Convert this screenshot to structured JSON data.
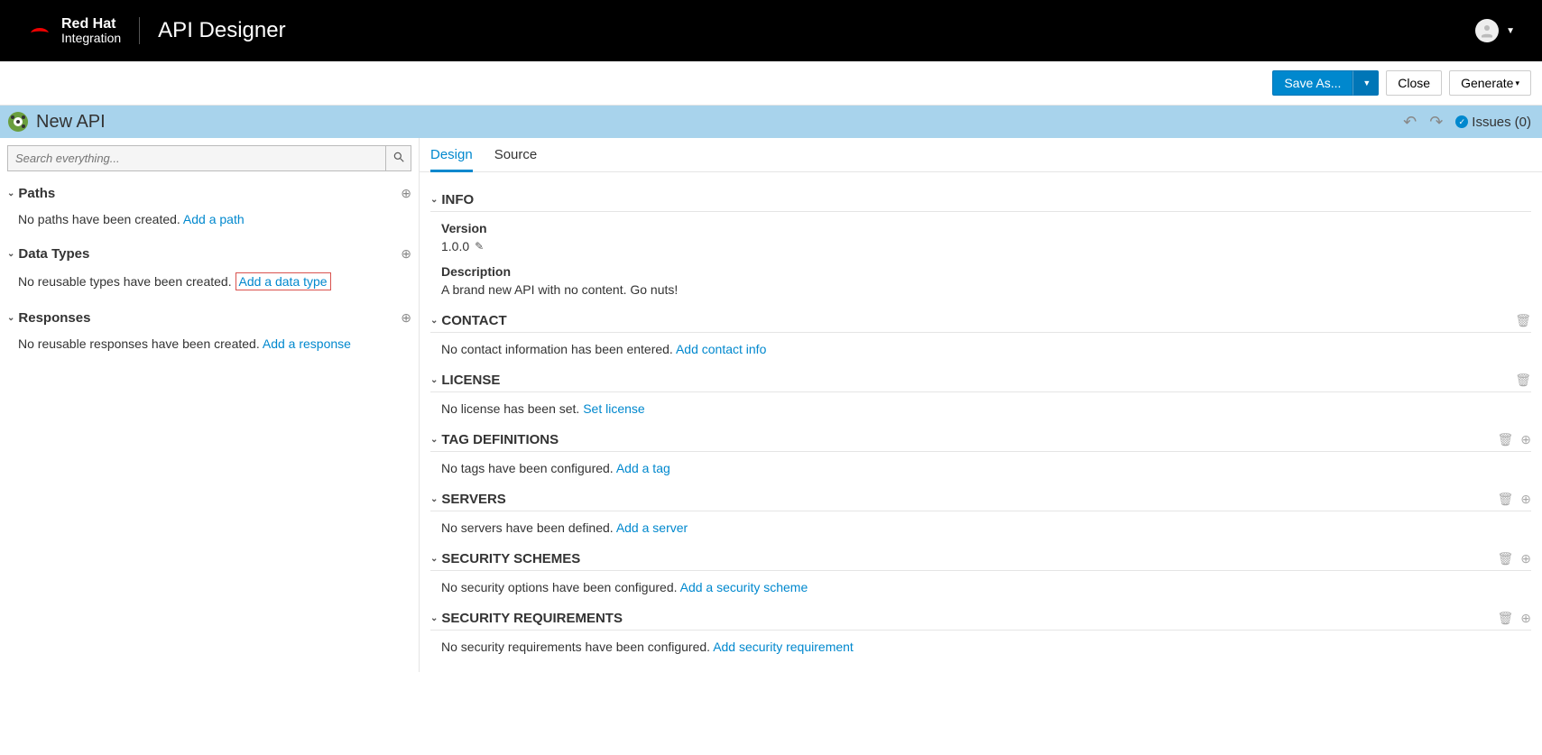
{
  "header": {
    "brand_bold": "Red Hat",
    "brand_sub": "Integration",
    "app_title": "API Designer"
  },
  "toolbar": {
    "save_as": "Save As...",
    "close": "Close",
    "generate": "Generate"
  },
  "titlebar": {
    "title": "New API",
    "issues_label": "Issues",
    "issues_count": "(0)"
  },
  "search": {
    "placeholder": "Search everything..."
  },
  "sidebar": {
    "paths": {
      "title": "Paths",
      "empty": "No paths have been created.",
      "add": "Add a path"
    },
    "datatypes": {
      "title": "Data Types",
      "empty": "No reusable types have been created.",
      "add": "Add a data type"
    },
    "responses": {
      "title": "Responses",
      "empty": "No reusable responses have been created.",
      "add": "Add a response"
    }
  },
  "tabs": {
    "design": "Design",
    "source": "Source"
  },
  "info": {
    "title": "INFO",
    "version_label": "Version",
    "version_value": "1.0.0",
    "desc_label": "Description",
    "desc_value": "A brand new API with no content. Go nuts!"
  },
  "contact": {
    "title": "CONTACT",
    "empty": "No contact information has been entered.",
    "add": "Add contact info"
  },
  "license": {
    "title": "LICENSE",
    "empty": "No license has been set.",
    "add": "Set license"
  },
  "tags": {
    "title": "TAG DEFINITIONS",
    "empty": "No tags have been configured.",
    "add": "Add a tag"
  },
  "servers": {
    "title": "SERVERS",
    "empty": "No servers have been defined.",
    "add": "Add a server"
  },
  "security_schemes": {
    "title": "SECURITY SCHEMES",
    "empty": "No security options have been configured.",
    "add": "Add a security scheme"
  },
  "security_req": {
    "title": "SECURITY REQUIREMENTS",
    "empty": "No security requirements have been configured.",
    "add": "Add security requirement"
  }
}
